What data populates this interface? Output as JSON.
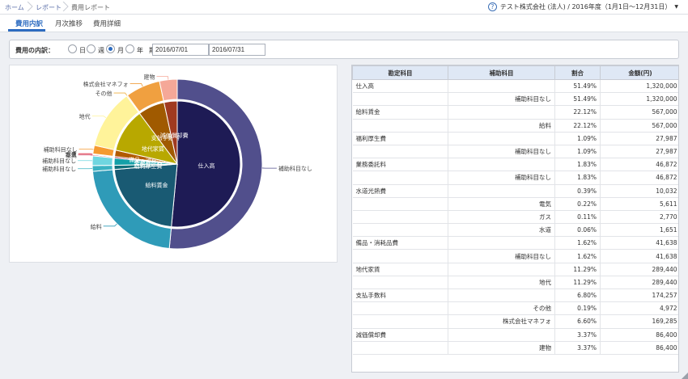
{
  "breadcrumb": {
    "home": "ホーム",
    "report": "レポート",
    "current": "費用レポート"
  },
  "header": {
    "company": "テスト株式会社 (法人) / 2016年度（1月1日〜12月31日）"
  },
  "tabs": [
    {
      "label": "費用内訳"
    },
    {
      "label": "月次推移"
    },
    {
      "label": "費用詳細"
    }
  ],
  "filter": {
    "label": "費用の内訳：",
    "options": [
      "日",
      "週",
      "月",
      "年"
    ],
    "selected": "月",
    "period_label": "期間",
    "from": "2016/07/01",
    "to": "2016/07/31",
    "tilde": "〜"
  },
  "colors": {
    "accent": "#2c6bc0"
  },
  "chart_data": {
    "type": "pie",
    "inner": [
      {
        "label": "仕入高",
        "value": 51.49,
        "color": "#1e1b55"
      },
      {
        "label": "給料賃金",
        "value": 22.12,
        "color": "#195a73"
      },
      {
        "label": "福利厚生費",
        "value": 1.09,
        "color": "#10707b"
      },
      {
        "label": "業務委託料",
        "value": 1.83,
        "color": "#14a0a8"
      },
      {
        "label": "水道光熱費",
        "value": 0.39,
        "color": "#a81030"
      },
      {
        "label": "備品・消耗品費",
        "value": 1.62,
        "color": "#b25a00"
      },
      {
        "label": "地代家賃",
        "value": 11.29,
        "color": "#b8a800"
      },
      {
        "label": "支払手数料",
        "value": 6.8,
        "color": "#a05a00"
      },
      {
        "label": "減価償却費",
        "value": 3.37,
        "color": "#a03a20"
      }
    ],
    "outer": [
      {
        "label": "補助科目なし",
        "value": 51.49,
        "color": "#514f8c"
      },
      {
        "label": "給料",
        "value": 22.12,
        "color": "#2f9bb8"
      },
      {
        "label": "補助科目なし",
        "value": 1.09,
        "color": "#3bb2c2"
      },
      {
        "label": "補助科目なし",
        "value": 1.83,
        "color": "#6fd6e0"
      },
      {
        "label": "電気",
        "value": 0.22,
        "color": "#d04060"
      },
      {
        "label": "ガス",
        "value": 0.11,
        "color": "#e06070"
      },
      {
        "label": "水道",
        "value": 0.06,
        "color": "#f07080"
      },
      {
        "label": "補助科目なし",
        "value": 1.62,
        "color": "#f59a30"
      },
      {
        "label": "地代",
        "value": 11.29,
        "color": "#fff39a"
      },
      {
        "label": "その他",
        "value": 0.19,
        "color": "#f0b040"
      },
      {
        "label": "株式会社マネフォ",
        "value": 6.6,
        "color": "#f0a040"
      },
      {
        "label": "建物",
        "value": 3.37,
        "color": "#f5a898"
      }
    ]
  },
  "table": {
    "headers": [
      "勘定科目",
      "補助科目",
      "割合",
      "金額(円)"
    ],
    "rows": [
      [
        "仕入高",
        "",
        "51.49%",
        "1,320,000"
      ],
      [
        "",
        "補助科目なし",
        "51.49%",
        "1,320,000"
      ],
      [
        "給料賃金",
        "",
        "22.12%",
        "567,000"
      ],
      [
        "",
        "給料",
        "22.12%",
        "567,000"
      ],
      [
        "福利厚生費",
        "",
        "1.09%",
        "27,987"
      ],
      [
        "",
        "補助科目なし",
        "1.09%",
        "27,987"
      ],
      [
        "業務委託料",
        "",
        "1.83%",
        "46,872"
      ],
      [
        "",
        "補助科目なし",
        "1.83%",
        "46,872"
      ],
      [
        "水道光熱費",
        "",
        "0.39%",
        "10,032"
      ],
      [
        "",
        "電気",
        "0.22%",
        "5,611"
      ],
      [
        "",
        "ガス",
        "0.11%",
        "2,770"
      ],
      [
        "",
        "水道",
        "0.06%",
        "1,651"
      ],
      [
        "備品・消耗品費",
        "",
        "1.62%",
        "41,638"
      ],
      [
        "",
        "補助科目なし",
        "1.62%",
        "41,638"
      ],
      [
        "地代家賃",
        "",
        "11.29%",
        "289,440"
      ],
      [
        "",
        "地代",
        "11.29%",
        "289,440"
      ],
      [
        "支払手数料",
        "",
        "6.80%",
        "174,257"
      ],
      [
        "",
        "その他",
        "0.19%",
        "4,972"
      ],
      [
        "",
        "株式会社マネフォ",
        "6.60%",
        "169,285"
      ],
      [
        "減価償却費",
        "",
        "3.37%",
        "86,400"
      ],
      [
        "",
        "建物",
        "3.37%",
        "86,400"
      ]
    ]
  }
}
